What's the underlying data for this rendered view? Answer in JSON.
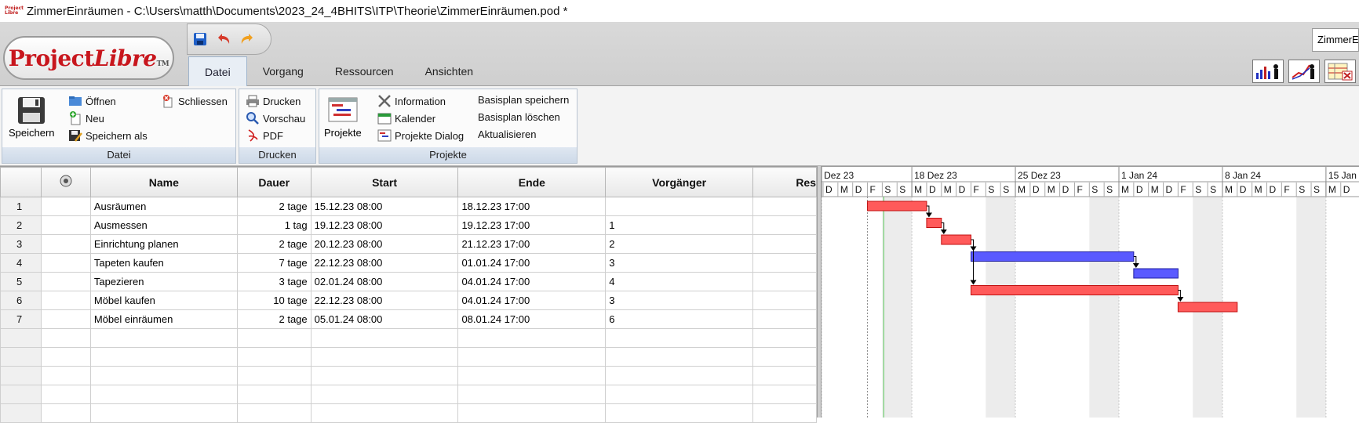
{
  "window": {
    "title": "ZimmerEinräumen - C:\\Users\\matth\\Documents\\2023_24_4BHITS\\ITP\\Theorie\\ZimmerEinräumen.pod *",
    "app_icon_text": "Project Libre"
  },
  "logo": {
    "text_a": "Project",
    "text_b": "Libre",
    "tm": "TM"
  },
  "quick_access": [
    {
      "icon": "save-icon"
    },
    {
      "icon": "undo-icon"
    },
    {
      "icon": "redo-icon"
    }
  ],
  "tabs": [
    {
      "label": "Datei",
      "active": true
    },
    {
      "label": "Vorgang"
    },
    {
      "label": "Ressourcen"
    },
    {
      "label": "Ansichten"
    }
  ],
  "project_dropdown": "ZimmerEinräumen",
  "view_icons": [
    "histogram-view-icon",
    "resource-usage-icon",
    "task-usage-icon"
  ],
  "ribbon": {
    "datei": {
      "label": "Datei",
      "save": "Speichern",
      "open": "Öffnen",
      "new": "Neu",
      "save_as": "Speichern als",
      "close": "Schliessen"
    },
    "drucken": {
      "label": "Drucken",
      "print": "Drucken",
      "preview": "Vorschau",
      "pdf": "PDF"
    },
    "projekte": {
      "label": "Projekte",
      "projects": "Projekte",
      "information": "Information",
      "calendar": "Kalender",
      "projects_dialog": "Projekte Dialog",
      "baseline_save": "Basisplan speichern",
      "baseline_delete": "Basisplan löschen",
      "refresh": "Aktualisieren"
    }
  },
  "table": {
    "headers": {
      "name": "Name",
      "duration": "Dauer",
      "start": "Start",
      "end": "Ende",
      "predecessors": "Vorgänger",
      "resources": "Res"
    },
    "rows": [
      {
        "id": "1",
        "name": "Ausräumen",
        "duration": "2 tage",
        "start": "15.12.23 08:00",
        "end": "18.12.23 17:00",
        "pred": ""
      },
      {
        "id": "2",
        "name": "Ausmessen",
        "duration": "1 tag",
        "start": "19.12.23 08:00",
        "end": "19.12.23 17:00",
        "pred": "1"
      },
      {
        "id": "3",
        "name": "Einrichtung planen",
        "duration": "2 tage",
        "start": "20.12.23 08:00",
        "end": "21.12.23 17:00",
        "pred": "2"
      },
      {
        "id": "4",
        "name": "Tapeten kaufen",
        "duration": "7 tage",
        "start": "22.12.23 08:00",
        "end": "01.01.24 17:00",
        "pred": "3"
      },
      {
        "id": "5",
        "name": "Tapezieren",
        "duration": "3 tage",
        "start": "02.01.24 08:00",
        "end": "04.01.24 17:00",
        "pred": "4"
      },
      {
        "id": "6",
        "name": "Möbel kaufen",
        "duration": "10 tage",
        "start": "22.12.23 08:00",
        "end": "04.01.24 17:00",
        "pred": "3"
      },
      {
        "id": "7",
        "name": "Möbel einräumen",
        "duration": "2 tage",
        "start": "05.01.24 08:00",
        "end": "08.01.24 17:00",
        "pred": "6"
      }
    ],
    "empty_rows": 5
  },
  "gantt": {
    "weeks": [
      "Dez 23",
      "18 Dez 23",
      "25 Dez 23",
      "1 Jan 24",
      "8 Jan 24",
      "15 Jan"
    ],
    "day_letters": [
      "D",
      "M",
      "D",
      "F",
      "S",
      "S",
      "M",
      "D",
      "M",
      "D",
      "F",
      "S",
      "S",
      "M",
      "D",
      "M",
      "D",
      "F",
      "S",
      "S",
      "M",
      "D",
      "M",
      "D",
      "F",
      "S",
      "S",
      "M",
      "D",
      "M",
      "D",
      "F",
      "S",
      "S",
      "M",
      "D"
    ],
    "first_day": "2023-12-12",
    "today_day_index": 4.1,
    "colors": {
      "critical": "#ff5a5a",
      "normal": "#5a5aff",
      "critical_border": "#c01010",
      "normal_border": "#2020a0",
      "weekend": "#ececec"
    },
    "bars": [
      {
        "task": "1",
        "start_day": 3.0,
        "end_day": 7.0,
        "critical": true
      },
      {
        "task": "2",
        "start_day": 7.0,
        "end_day": 8.0,
        "critical": true
      },
      {
        "task": "3",
        "start_day": 8.0,
        "end_day": 10.0,
        "critical": true
      },
      {
        "task": "4",
        "start_day": 10.0,
        "end_day": 21.0,
        "critical": false
      },
      {
        "task": "5",
        "start_day": 21.0,
        "end_day": 24.0,
        "critical": false
      },
      {
        "task": "6",
        "start_day": 10.0,
        "end_day": 24.0,
        "critical": true
      },
      {
        "task": "7",
        "start_day": 24.0,
        "end_day": 28.0,
        "critical": true
      }
    ],
    "links": [
      {
        "from": "1",
        "to": "2"
      },
      {
        "from": "2",
        "to": "3"
      },
      {
        "from": "3",
        "to": "4"
      },
      {
        "from": "3",
        "to": "6"
      },
      {
        "from": "4",
        "to": "5"
      },
      {
        "from": "6",
        "to": "7"
      }
    ]
  }
}
